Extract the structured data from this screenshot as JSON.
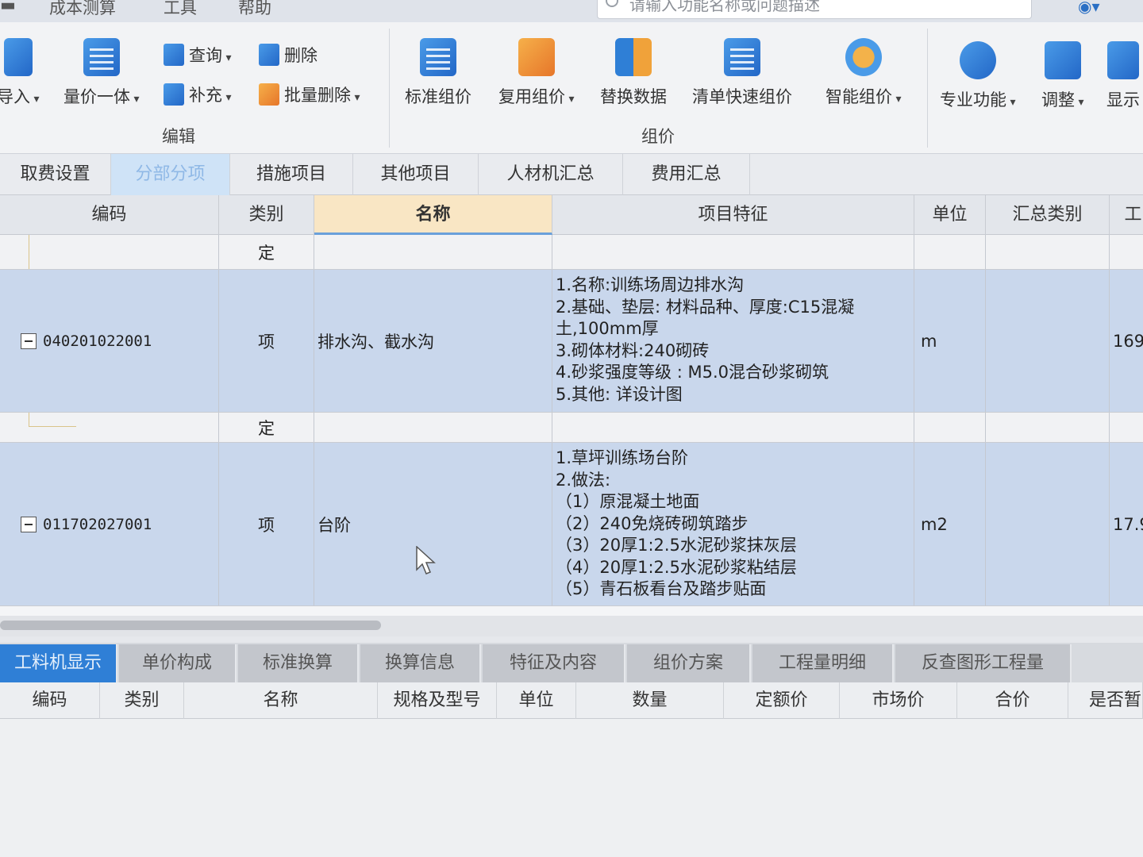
{
  "menu": {
    "items": [
      "成本测算",
      "工具",
      "帮助"
    ]
  },
  "search": {
    "placeholder": "请输入功能名称或问题描述"
  },
  "ribbon": {
    "edit_group": {
      "label": "编辑",
      "import": "导入",
      "qty_price": "量价一体",
      "query": "查询",
      "supplement": "补充",
      "delete": "删除",
      "batch_delete": "批量删除"
    },
    "price_group": {
      "label": "组价",
      "standard": "标准组价",
      "reuse": "复用组价",
      "replace": "替换数据",
      "quick": "清单快速组价",
      "smart": "智能组价"
    },
    "pro": "专业功能",
    "adjust": "调整",
    "display": "显示"
  },
  "tabs": [
    "取费设置",
    "分部分项",
    "措施项目",
    "其他项目",
    "人材机汇总",
    "费用汇总"
  ],
  "grid": {
    "headers": {
      "code": "编码",
      "type": "类别",
      "name": "名称",
      "feature": "项目特征",
      "unit": "单位",
      "summary": "汇总类别",
      "qty": "工"
    },
    "rows": [
      {
        "type": "定"
      },
      {
        "code": "040201022001",
        "type": "项",
        "name": "排水沟、截水沟",
        "features": [
          "1.名称:训练场周边排水沟",
          "2.基础、垫层: 材料品种、厚度:C15混凝",
          "土,100mm厚",
          "3.砌体材料:240砌砖",
          "4.砂浆强度等级 : M5.0混合砂浆砌筑",
          "5.其他: 详设计图"
        ],
        "unit": "m",
        "qty": "169"
      },
      {
        "type": "定"
      },
      {
        "code": "011702027001",
        "type": "项",
        "name": "台阶",
        "features": [
          "1.草坪训练场台阶",
          "2.做法:",
          "（1）原混凝土地面",
          "（2）240免烧砖砌筑踏步",
          "（3）20厚1:2.5水泥砂浆抹灰层",
          "（4）20厚1:2.5水泥砂浆粘结层",
          "（5）青石板看台及踏步贴面"
        ],
        "unit": "m2",
        "qty": "17.9"
      }
    ]
  },
  "bottom": {
    "tabs": [
      "工料机显示",
      "单价构成",
      "标准换算",
      "换算信息",
      "特征及内容",
      "组价方案",
      "工程量明细",
      "反查图形工程量"
    ],
    "headers": [
      "编码",
      "类别",
      "名称",
      "规格及型号",
      "单位",
      "数量",
      "定额价",
      "市场价",
      "合价",
      "是否暂"
    ]
  },
  "colors": {
    "accent": "#2f7fd6",
    "selected_row": "#c9d7ec",
    "active_tab": "#cfe3f7"
  }
}
